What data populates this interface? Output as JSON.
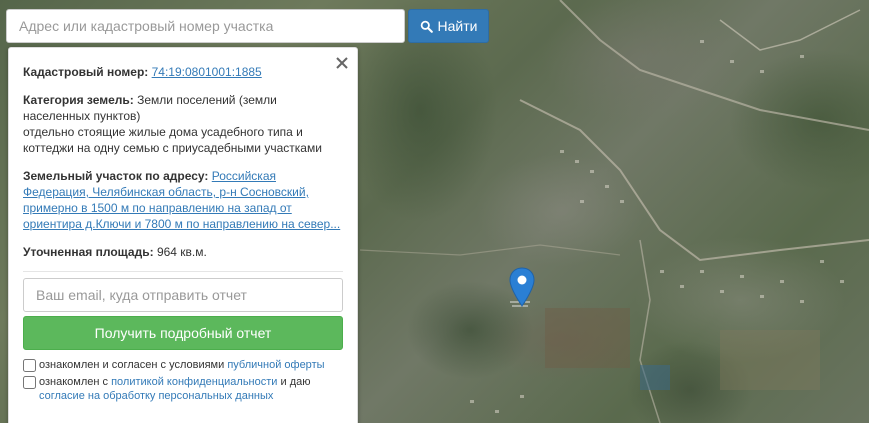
{
  "search": {
    "placeholder": "Адрес или кадастровый номер участка",
    "button_label": "Найти"
  },
  "info": {
    "cadastral_label": "Кадастровый номер:",
    "cadastral_value": "74:19:0801001:1885",
    "category_label": "Категория земель:",
    "category_value": "Земли поселений (земли населенных пунктов)",
    "usage_value": "отдельно стоящие жилые дома усадебного типа и коттеджи на одну семью с приусадебными участками",
    "address_label": "Земельный участок по адресу:",
    "address_value": "Российская Федерация, Челябинская область, р-н Сосновский, примерно в 1500 м по направлению на запад от ориентира д.Ключи и 7800 м по направлению на север...",
    "area_label": "Уточненная площадь:",
    "area_value": "964 кв.м."
  },
  "report": {
    "email_placeholder": "Ваш email, куда отправить отчет",
    "button_label": "Получить подробный отчет",
    "agree1_text": "ознакомлен и согласен с условиями",
    "agree1_link": "публичной оферты",
    "agree2_text_a": "ознакомлен с",
    "agree2_link_a": "политикой конфиденциальности",
    "agree2_text_b": "и даю",
    "agree2_link_b": "согласие на обработку персональных данных"
  },
  "colors": {
    "primary": "#337ab7",
    "success": "#5cb85c",
    "marker": "#2a7fd4"
  }
}
